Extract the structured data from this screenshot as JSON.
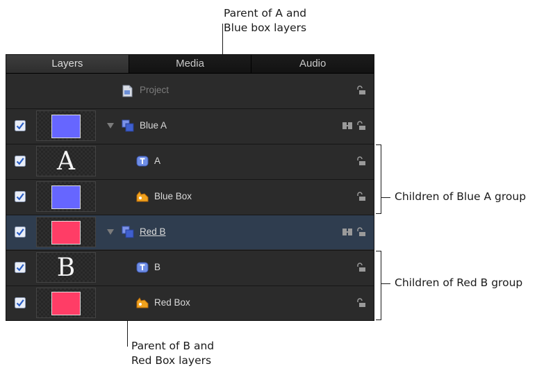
{
  "tabs": [
    "Layers",
    "Media",
    "Audio"
  ],
  "project_label": "Project",
  "layers": [
    {
      "name": "Blue A",
      "checked": true,
      "kind": "group",
      "thumb": "swatch",
      "swatch_color": "#6666ff",
      "depth": 0,
      "selected": false
    },
    {
      "name": "A",
      "checked": true,
      "kind": "text",
      "thumb": "letter",
      "thumb_letter": "A",
      "depth": 1,
      "selected": false
    },
    {
      "name": "Blue Box",
      "checked": true,
      "kind": "shape",
      "thumb": "swatch",
      "swatch_color": "#6666ff",
      "depth": 1,
      "selected": false
    },
    {
      "name": "Red B",
      "checked": true,
      "kind": "group",
      "thumb": "swatch",
      "swatch_color": "#ff3d66",
      "depth": 0,
      "selected": true
    },
    {
      "name": "B",
      "checked": true,
      "kind": "text",
      "thumb": "letter",
      "thumb_letter": "B",
      "depth": 1,
      "selected": false
    },
    {
      "name": "Red Box",
      "checked": true,
      "kind": "shape",
      "thumb": "swatch",
      "swatch_color": "#ff3d66",
      "depth": 1,
      "selected": false
    }
  ],
  "callouts": {
    "parent_a": [
      "Parent of A and",
      "Blue box layers"
    ],
    "children_blue": "Children of Blue A group",
    "children_red": "Children of Red B group",
    "parent_b": [
      "Parent of B and",
      "Red Box layers"
    ]
  }
}
